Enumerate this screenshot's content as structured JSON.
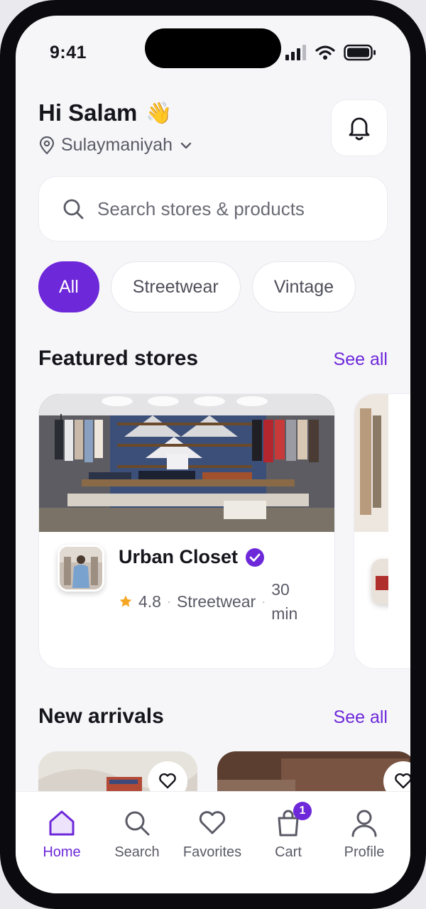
{
  "status_bar": {
    "time": "9:41"
  },
  "header": {
    "greeting": "Hi Salam",
    "wave_emoji": "👋",
    "location": "Sulaymaniyah"
  },
  "search": {
    "placeholder": "Search stores & products"
  },
  "categories": [
    {
      "label": "All",
      "active": true
    },
    {
      "label": "Streetwear",
      "active": false
    },
    {
      "label": "Vintage",
      "active": false
    }
  ],
  "featured": {
    "title": "Featured stores",
    "see_all": "See all",
    "stores": [
      {
        "name": "Urban Closet",
        "verified": true,
        "rating": "4.8",
        "category": "Streetwear",
        "delivery_time": "30 min"
      }
    ]
  },
  "new_arrivals": {
    "title": "New arrivals",
    "see_all": "See all"
  },
  "bottom_nav": [
    {
      "label": "Home",
      "icon": "home-icon",
      "active": true
    },
    {
      "label": "Search",
      "icon": "search-icon",
      "active": false
    },
    {
      "label": "Favorites",
      "icon": "heart-icon",
      "active": false
    },
    {
      "label": "Cart",
      "icon": "shopping-bag-icon",
      "active": false,
      "badge": "1"
    },
    {
      "label": "Profile",
      "icon": "user-icon",
      "active": false
    }
  ],
  "colors": {
    "accent": "#6d28d9",
    "star": "#f5a623",
    "background": "#f6f6f9"
  }
}
